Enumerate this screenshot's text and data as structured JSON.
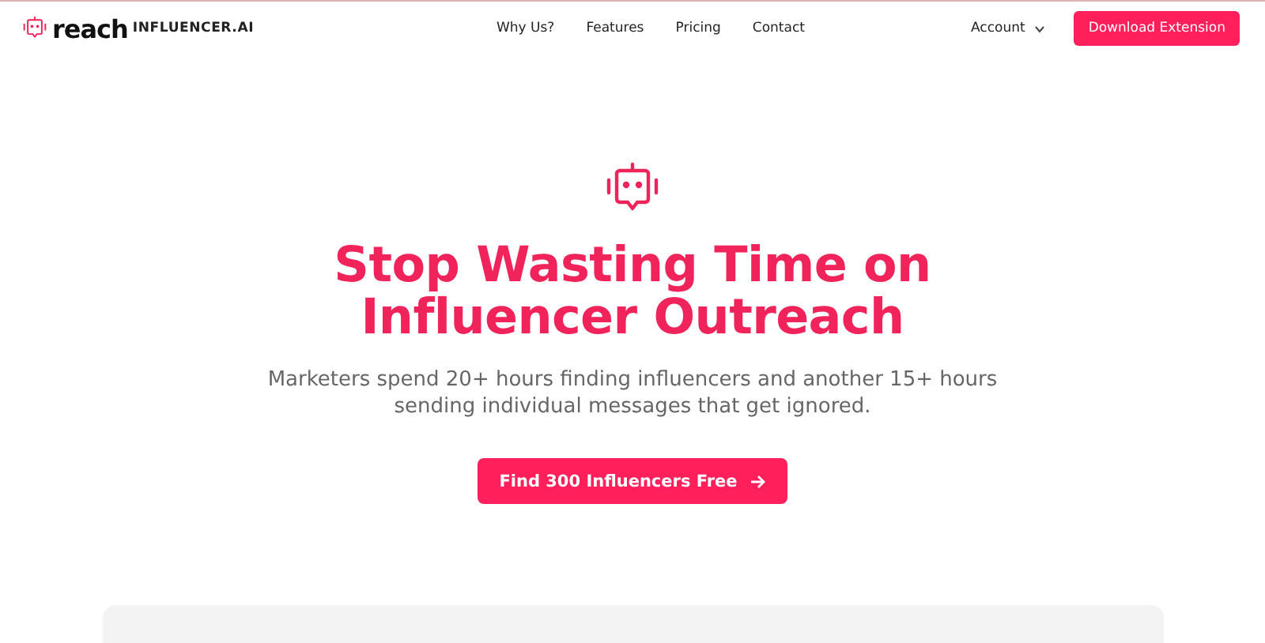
{
  "header": {
    "logo": {
      "wordmark": "reach",
      "suffix": "INFLUENCER.AI"
    },
    "nav": [
      "Why Us?",
      "Features",
      "Pricing",
      "Contact"
    ],
    "account": {
      "label": "Account",
      "expanded": false
    },
    "cta": "Download Extension"
  },
  "hero": {
    "headline": [
      "Stop Wasting Time on",
      "Influencer Outreach"
    ],
    "subtitle": "Marketers spend 20+ hours finding influencers and another 15+ hours sending individual messages that get ignored.",
    "button": "Find 300 Influencers Free"
  }
}
